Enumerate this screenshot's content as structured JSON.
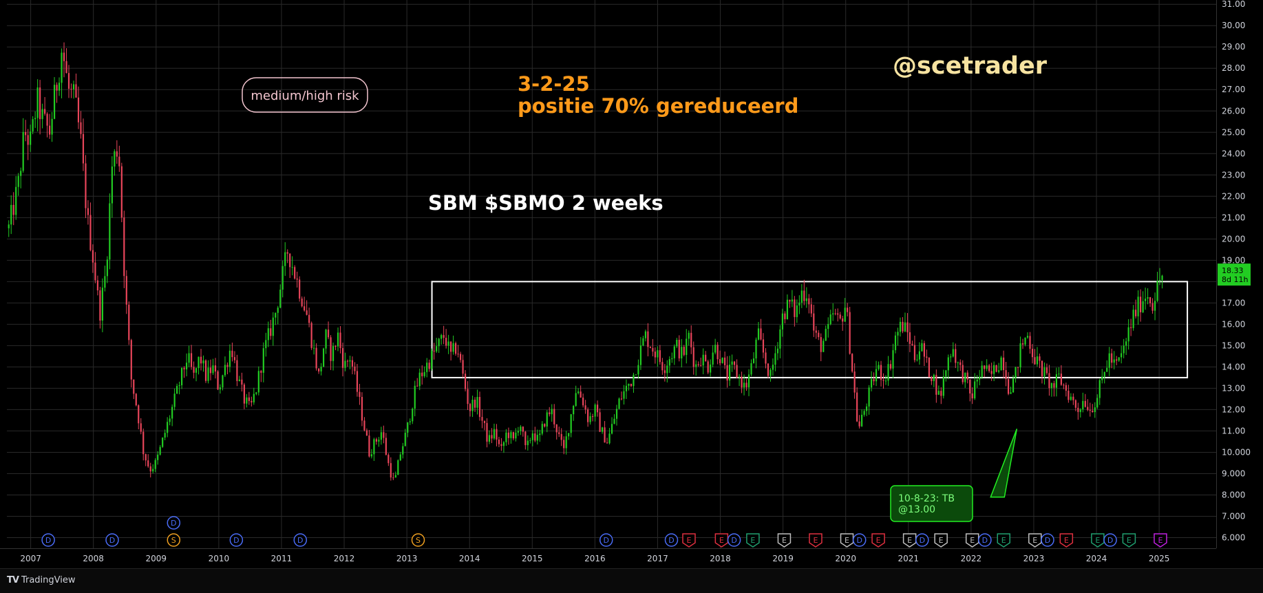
{
  "chart_data": {
    "type": "candlestick",
    "title": "SBM $SBMO 2 weeks",
    "interval": "2 weeks",
    "ylim": [
      5.5,
      31.2
    ],
    "y_ticks": [
      "31.00",
      "30.00",
      "29.00",
      "28.00",
      "27.00",
      "26.00",
      "25.00",
      "24.00",
      "23.00",
      "22.00",
      "21.00",
      "20.00",
      "19.00",
      "18.00",
      "17.00",
      "16.00",
      "15.00",
      "14.00",
      "13.00",
      "12.00",
      "11.00",
      "10.000",
      "9.000",
      "8.000",
      "7.000",
      "6.000"
    ],
    "x_ticks": [
      "2007",
      "2008",
      "2009",
      "2010",
      "2011",
      "2012",
      "2013",
      "2014",
      "2015",
      "2016",
      "2017",
      "2018",
      "2019",
      "2020",
      "2021",
      "2022",
      "2023",
      "2024",
      "2025"
    ],
    "xlim": [
      2006.67,
      2025.96
    ],
    "price_path": [
      [
        2006.7,
        20.5
      ],
      [
        2006.85,
        22.5
      ],
      [
        2006.95,
        25.0
      ],
      [
        2007.05,
        24.5
      ],
      [
        2007.15,
        26.5
      ],
      [
        2007.25,
        25.5
      ],
      [
        2007.35,
        25.0
      ],
      [
        2007.45,
        27.0
      ],
      [
        2007.55,
        29.0
      ],
      [
        2007.65,
        27.0
      ],
      [
        2007.75,
        26.5
      ],
      [
        2007.85,
        24.5
      ],
      [
        2007.95,
        21.0
      ],
      [
        2008.05,
        19.0
      ],
      [
        2008.15,
        16.5
      ],
      [
        2008.25,
        18.5
      ],
      [
        2008.35,
        23.5
      ],
      [
        2008.45,
        24.5
      ],
      [
        2008.55,
        18.0
      ],
      [
        2008.65,
        13.5
      ],
      [
        2008.75,
        12.0
      ],
      [
        2008.85,
        10.0
      ],
      [
        2008.95,
        9.2
      ],
      [
        2009.05,
        9.5
      ],
      [
        2009.15,
        10.5
      ],
      [
        2009.25,
        11.5
      ],
      [
        2009.35,
        12.5
      ],
      [
        2009.45,
        13.5
      ],
      [
        2009.55,
        14.5
      ],
      [
        2009.65,
        13.5
      ],
      [
        2009.75,
        14.5
      ],
      [
        2009.85,
        13.5
      ],
      [
        2009.95,
        14.0
      ],
      [
        2010.05,
        13.0
      ],
      [
        2010.15,
        14.0
      ],
      [
        2010.25,
        15.0
      ],
      [
        2010.35,
        13.5
      ],
      [
        2010.45,
        12.5
      ],
      [
        2010.55,
        12.0
      ],
      [
        2010.65,
        13.0
      ],
      [
        2010.75,
        14.5
      ],
      [
        2010.85,
        15.5
      ],
      [
        2010.95,
        16.5
      ],
      [
        2011.05,
        18.0
      ],
      [
        2011.15,
        19.5
      ],
      [
        2011.25,
        18.5
      ],
      [
        2011.35,
        17.5
      ],
      [
        2011.45,
        16.5
      ],
      [
        2011.55,
        15.0
      ],
      [
        2011.65,
        13.5
      ],
      [
        2011.75,
        15.5
      ],
      [
        2011.85,
        14.5
      ],
      [
        2011.95,
        15.5
      ],
      [
        2012.05,
        14.0
      ],
      [
        2012.15,
        14.5
      ],
      [
        2012.25,
        13.0
      ],
      [
        2012.35,
        11.5
      ],
      [
        2012.45,
        10.0
      ],
      [
        2012.55,
        10.5
      ],
      [
        2012.65,
        11.0
      ],
      [
        2012.75,
        9.5
      ],
      [
        2012.85,
        8.5
      ],
      [
        2012.95,
        10.0
      ],
      [
        2013.05,
        11.0
      ],
      [
        2013.15,
        12.5
      ],
      [
        2013.25,
        13.5
      ],
      [
        2013.35,
        14.0
      ],
      [
        2013.45,
        14.5
      ],
      [
        2013.55,
        15.0
      ],
      [
        2013.65,
        15.5
      ],
      [
        2013.75,
        14.5
      ],
      [
        2013.85,
        15.0
      ],
      [
        2013.95,
        13.5
      ],
      [
        2014.05,
        12.0
      ],
      [
        2014.15,
        12.5
      ],
      [
        2014.25,
        11.5
      ],
      [
        2014.35,
        10.5
      ],
      [
        2014.45,
        11.0
      ],
      [
        2014.55,
        10.0
      ],
      [
        2014.65,
        11.0
      ],
      [
        2014.75,
        10.5
      ],
      [
        2014.85,
        11.5
      ],
      [
        2014.95,
        10.0
      ],
      [
        2015.05,
        11.0
      ],
      [
        2015.15,
        10.5
      ],
      [
        2015.25,
        11.5
      ],
      [
        2015.35,
        12.0
      ],
      [
        2015.45,
        11.0
      ],
      [
        2015.55,
        10.0
      ],
      [
        2015.65,
        11.5
      ],
      [
        2015.75,
        13.0
      ],
      [
        2015.85,
        12.5
      ],
      [
        2015.95,
        11.5
      ],
      [
        2016.05,
        12.0
      ],
      [
        2016.15,
        11.0
      ],
      [
        2016.25,
        10.5
      ],
      [
        2016.35,
        11.5
      ],
      [
        2016.45,
        12.5
      ],
      [
        2016.55,
        13.0
      ],
      [
        2016.65,
        13.5
      ],
      [
        2016.75,
        14.5
      ],
      [
        2016.85,
        15.5
      ],
      [
        2016.95,
        15.0
      ],
      [
        2017.05,
        14.5
      ],
      [
        2017.15,
        14.0
      ],
      [
        2017.25,
        14.5
      ],
      [
        2017.35,
        15.0
      ],
      [
        2017.45,
        14.5
      ],
      [
        2017.55,
        15.5
      ],
      [
        2017.65,
        14.0
      ],
      [
        2017.75,
        14.5
      ],
      [
        2017.85,
        14.0
      ],
      [
        2017.95,
        15.0
      ],
      [
        2018.05,
        14.5
      ],
      [
        2018.15,
        13.5
      ],
      [
        2018.25,
        14.0
      ],
      [
        2018.35,
        13.5
      ],
      [
        2018.45,
        13.0
      ],
      [
        2018.55,
        14.0
      ],
      [
        2018.65,
        15.5
      ],
      [
        2018.75,
        14.5
      ],
      [
        2018.85,
        13.5
      ],
      [
        2018.95,
        15.0
      ],
      [
        2019.05,
        16.5
      ],
      [
        2019.15,
        17.0
      ],
      [
        2019.25,
        16.5
      ],
      [
        2019.35,
        17.5
      ],
      [
        2019.45,
        17.5
      ],
      [
        2019.55,
        15.5
      ],
      [
        2019.65,
        15.0
      ],
      [
        2019.75,
        15.5
      ],
      [
        2019.85,
        16.5
      ],
      [
        2019.95,
        16.0
      ],
      [
        2020.05,
        17.0
      ],
      [
        2020.15,
        14.0
      ],
      [
        2020.25,
        11.0
      ],
      [
        2020.35,
        12.0
      ],
      [
        2020.45,
        13.0
      ],
      [
        2020.55,
        14.0
      ],
      [
        2020.65,
        13.5
      ],
      [
        2020.75,
        14.0
      ],
      [
        2020.85,
        15.5
      ],
      [
        2020.95,
        16.0
      ],
      [
        2021.05,
        15.5
      ],
      [
        2021.15,
        14.5
      ],
      [
        2021.25,
        15.0
      ],
      [
        2021.35,
        14.0
      ],
      [
        2021.45,
        13.5
      ],
      [
        2021.55,
        12.5
      ],
      [
        2021.65,
        14.0
      ],
      [
        2021.75,
        15.0
      ],
      [
        2021.85,
        14.0
      ],
      [
        2021.95,
        13.5
      ],
      [
        2022.05,
        12.5
      ],
      [
        2022.15,
        13.5
      ],
      [
        2022.25,
        14.0
      ],
      [
        2022.35,
        13.5
      ],
      [
        2022.45,
        14.0
      ],
      [
        2022.55,
        14.5
      ],
      [
        2022.65,
        13.0
      ],
      [
        2022.75,
        13.5
      ],
      [
        2022.85,
        15.0
      ],
      [
        2022.95,
        15.5
      ],
      [
        2023.05,
        14.5
      ],
      [
        2023.15,
        14.0
      ],
      [
        2023.25,
        13.5
      ],
      [
        2023.35,
        13.0
      ],
      [
        2023.45,
        13.5
      ],
      [
        2023.55,
        13.0
      ],
      [
        2023.65,
        12.5
      ],
      [
        2023.75,
        12.0
      ],
      [
        2023.85,
        12.5
      ],
      [
        2023.95,
        12.0
      ],
      [
        2024.05,
        12.5
      ],
      [
        2024.15,
        13.5
      ],
      [
        2024.25,
        14.5
      ],
      [
        2024.35,
        14.0
      ],
      [
        2024.45,
        14.5
      ],
      [
        2024.55,
        15.5
      ],
      [
        2024.65,
        16.5
      ],
      [
        2024.75,
        17.0
      ],
      [
        2024.85,
        17.5
      ],
      [
        2024.95,
        17.0
      ],
      [
        2025.05,
        18.0
      ],
      [
        2025.1,
        18.33
      ]
    ],
    "last_price": "18.33",
    "countdown": "8d 11h",
    "range_box": {
      "x_start": 2013.45,
      "x_end": 2025.5,
      "y_low": 13.5,
      "y_high": 18.0
    },
    "callout_arrow": {
      "from": [
        2022.45,
        7.9
      ],
      "to": [
        2022.78,
        11.1
      ]
    },
    "event_markers": [
      {
        "x": 2007.33,
        "label": "D",
        "color": "#4a6cf7",
        "shape": "circle"
      },
      {
        "x": 2008.35,
        "label": "D",
        "color": "#4a6cf7",
        "shape": "circle"
      },
      {
        "x": 2009.33,
        "label": "D",
        "color": "#4a6cf7",
        "shape": "circle",
        "row": 2
      },
      {
        "x": 2009.33,
        "label": "S",
        "color": "#f0a020",
        "shape": "circle"
      },
      {
        "x": 2010.33,
        "label": "D",
        "color": "#4a6cf7",
        "shape": "circle"
      },
      {
        "x": 2011.35,
        "label": "D",
        "color": "#4a6cf7",
        "shape": "circle"
      },
      {
        "x": 2013.23,
        "label": "S",
        "color": "#f0a020",
        "shape": "circle"
      },
      {
        "x": 2016.23,
        "label": "D",
        "color": "#4a6cf7",
        "shape": "circle"
      },
      {
        "x": 2017.27,
        "label": "D",
        "color": "#4a6cf7",
        "shape": "circle"
      },
      {
        "x": 2017.55,
        "label": "E",
        "color": "#e03040",
        "shape": "tag"
      },
      {
        "x": 2018.07,
        "label": "E",
        "color": "#e03040",
        "shape": "tag"
      },
      {
        "x": 2018.27,
        "label": "D",
        "color": "#4a6cf7",
        "shape": "circle"
      },
      {
        "x": 2018.57,
        "label": "E",
        "color": "#20a070",
        "shape": "tag"
      },
      {
        "x": 2019.07,
        "label": "E",
        "color": "#c0c0c0",
        "shape": "tag"
      },
      {
        "x": 2019.57,
        "label": "E",
        "color": "#e03040",
        "shape": "tag"
      },
      {
        "x": 2020.07,
        "label": "E",
        "color": "#c0c0c0",
        "shape": "tag"
      },
      {
        "x": 2020.27,
        "label": "D",
        "color": "#4a6cf7",
        "shape": "circle"
      },
      {
        "x": 2020.57,
        "label": "E",
        "color": "#e03040",
        "shape": "tag"
      },
      {
        "x": 2021.07,
        "label": "E",
        "color": "#c0c0c0",
        "shape": "tag"
      },
      {
        "x": 2021.27,
        "label": "D",
        "color": "#4a6cf7",
        "shape": "circle"
      },
      {
        "x": 2021.57,
        "label": "E",
        "color": "#c0c0c0",
        "shape": "tag"
      },
      {
        "x": 2022.07,
        "label": "E",
        "color": "#c0c0c0",
        "shape": "tag"
      },
      {
        "x": 2022.27,
        "label": "D",
        "color": "#4a6cf7",
        "shape": "circle"
      },
      {
        "x": 2022.57,
        "label": "E",
        "color": "#20a070",
        "shape": "tag"
      },
      {
        "x": 2023.07,
        "label": "E",
        "color": "#c0c0c0",
        "shape": "tag"
      },
      {
        "x": 2023.27,
        "label": "D",
        "color": "#4a6cf7",
        "shape": "circle"
      },
      {
        "x": 2023.57,
        "label": "E",
        "color": "#e03040",
        "shape": "tag"
      },
      {
        "x": 2024.07,
        "label": "E",
        "color": "#20a070",
        "shape": "tag"
      },
      {
        "x": 2024.27,
        "label": "D",
        "color": "#4a6cf7",
        "shape": "circle"
      },
      {
        "x": 2024.57,
        "label": "E",
        "color": "#20a070",
        "shape": "tag"
      },
      {
        "x": 2025.07,
        "label": "E",
        "color": "#c020e0",
        "shape": "tag"
      }
    ],
    "colors": {
      "up": "#22cc22",
      "down": "#e8455a",
      "grid": "#2a2a2a",
      "axis_text": "#d1d4dc",
      "box": "#ffffff",
      "last_price_bg": "#22cc22"
    }
  },
  "annotations": {
    "title": "SBM $SBMO 2 weeks",
    "risk_label": "medium/high risk",
    "date_note": "3-2-25",
    "position_note": "positie 70% gereduceerd",
    "handle": "@scetrader",
    "callout_line1": "10-8-23: TB",
    "callout_line2": "@13.00"
  },
  "branding": {
    "logo_text": "TradingView"
  }
}
